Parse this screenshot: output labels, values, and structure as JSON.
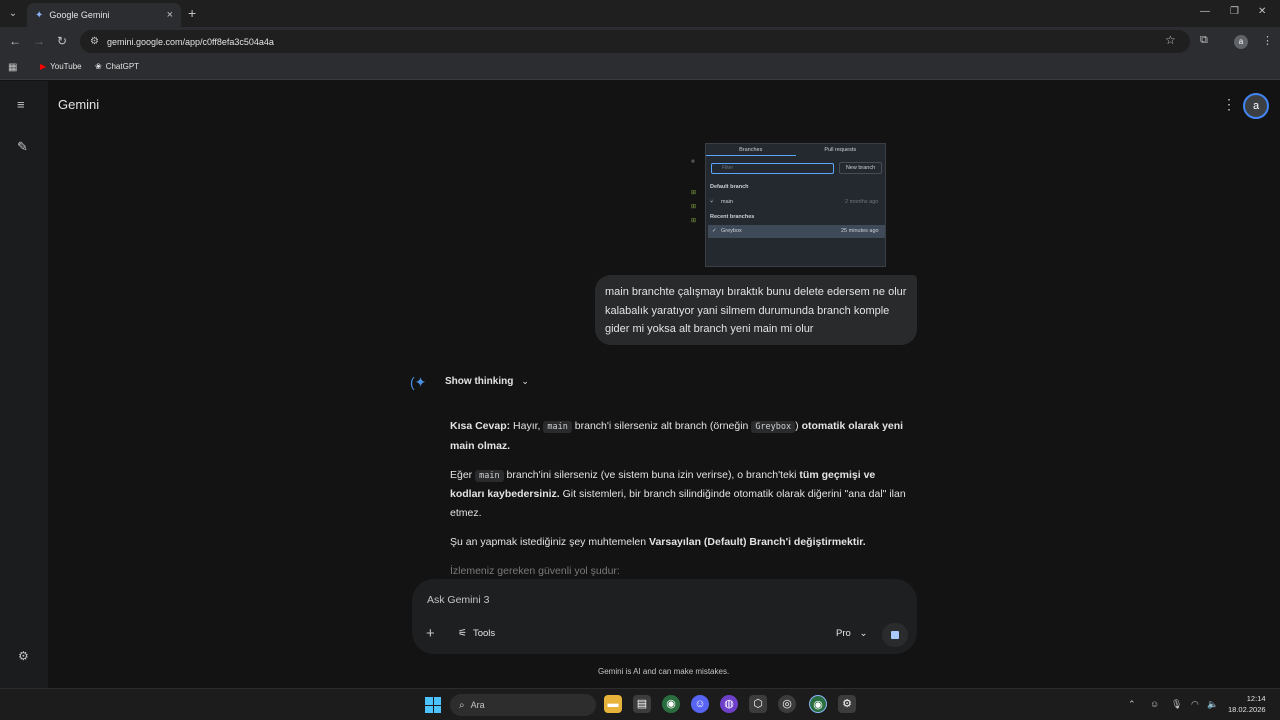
{
  "browser": {
    "tab_title": "Google Gemini",
    "new_tab": "+",
    "url": "gemini.google.com/app/c0ff8efa3c504a4a",
    "bookmarks": [
      {
        "label": "YouTube",
        "icon": "youtube-icon"
      },
      {
        "label": "ChatGPT",
        "icon": "chatgpt-icon"
      }
    ],
    "profile_initial": "a"
  },
  "app": {
    "title": "Gemini",
    "avatar_initial": "a"
  },
  "attachment": {
    "tabs": [
      "Branches",
      "Pull requests"
    ],
    "filter_placeholder": "Filter",
    "new_branch": "New branch",
    "default_branch_header": "Default branch",
    "default_branch_name": "main",
    "default_branch_time": "2 months ago",
    "recent_header": "Recent branches",
    "recent_branch_name": "Greybox",
    "recent_branch_time": "25 minutes ago"
  },
  "user_message": "main branchte çalışmayı bıraktık bunu delete edersem ne olur kalabalık yaratıyor yani silmem durumunda branch komple gider mi yoksa alt branch yeni main mi olur",
  "response": {
    "show_thinking": "Show thinking",
    "p1_label": "Kısa Cevap:",
    "p1_a": "Hayır,",
    "p1_code1": "main",
    "p1_b": "branch'i silerseniz alt branch (örneğin",
    "p1_code2": "Greybox",
    "p1_c": ")",
    "p1_bold": "otomatik olarak yeni main olmaz.",
    "p2_a": "Eğer",
    "p2_code": "main",
    "p2_b": "branch'ini silerseniz (ve sistem buna izin verirse), o branch'teki",
    "p2_bold": "tüm geçmişi ve kodları kaybedersiniz.",
    "p2_c": "Git sistemleri, bir branch silindiğinde otomatik olarak diğerini \"ana dal\" ilan etmez.",
    "p3_a": "Şu an yapmak istediğiniz şey muhtemelen",
    "p3_bold": "Varsayılan (Default) Branch'i değiştirmektir.",
    "p4": "İzlemeniz gereken güvenli yol şudur:"
  },
  "input": {
    "placeholder": "Ask Gemini 3",
    "tools": "Tools",
    "mode": "Pro"
  },
  "disclaimer": "Gemini is AI and can make mistakes.",
  "taskbar": {
    "search": "Ara",
    "time": "12:14",
    "date": "18.02.2026"
  }
}
